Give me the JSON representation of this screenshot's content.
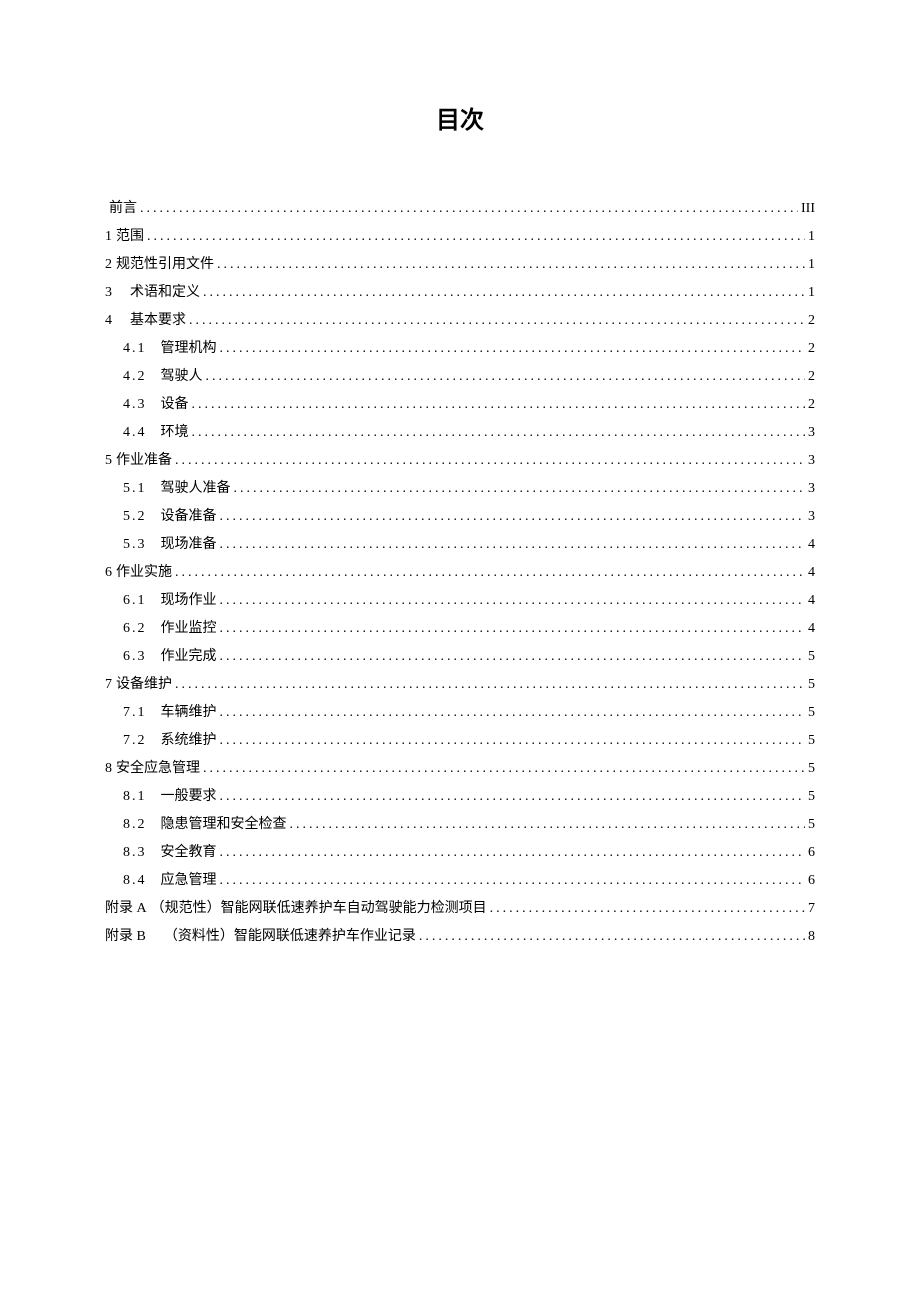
{
  "title": "目次",
  "entries": [
    {
      "level": 1,
      "num": "",
      "label": "前言",
      "page": "III",
      "numClass": "",
      "labelClass": ""
    },
    {
      "level": 1,
      "num": "1",
      "label": "范围",
      "page": "1",
      "numClass": "",
      "labelClass": ""
    },
    {
      "level": 1,
      "num": "2",
      "label": "规范性引用文件",
      "page": "1",
      "numClass": "",
      "labelClass": ""
    },
    {
      "level": 1,
      "num": "3",
      "label": "术语和定义",
      "page": "1",
      "numClass": "",
      "labelClass": "indent"
    },
    {
      "level": 1,
      "num": "4",
      "label": "基本要求",
      "page": "2",
      "numClass": "",
      "labelClass": "indent"
    },
    {
      "level": 2,
      "num": "4.1",
      "label": "管理机构",
      "page": "2",
      "numClass": "spaced",
      "labelClass": "wide-gap"
    },
    {
      "level": 2,
      "num": "4.2",
      "label": "驾驶人",
      "page": "2",
      "numClass": "spaced",
      "labelClass": "wide-gap"
    },
    {
      "level": 2,
      "num": "4.3",
      "label": "设备",
      "page": "2",
      "numClass": "spaced",
      "labelClass": "wide-gap"
    },
    {
      "level": 2,
      "num": "4.4",
      "label": "环境",
      "page": "3",
      "numClass": "spaced",
      "labelClass": "wide-gap"
    },
    {
      "level": 1,
      "num": "5",
      "label": "作业准备",
      "page": "3",
      "numClass": "",
      "labelClass": ""
    },
    {
      "level": 2,
      "num": "5.1",
      "label": "驾驶人准备",
      "page": "3",
      "numClass": "spaced",
      "labelClass": "wide-gap"
    },
    {
      "level": 2,
      "num": "5.2",
      "label": "设备准备",
      "page": "3",
      "numClass": "spaced",
      "labelClass": "wide-gap"
    },
    {
      "level": 2,
      "num": "5.3",
      "label": "现场准备",
      "page": "4",
      "numClass": "spaced",
      "labelClass": "wide-gap"
    },
    {
      "level": 1,
      "num": "6",
      "label": "作业实施",
      "page": "4",
      "numClass": "",
      "labelClass": ""
    },
    {
      "level": 2,
      "num": "6.1",
      "label": "现场作业",
      "page": "4",
      "numClass": "spaced",
      "labelClass": "wide-gap"
    },
    {
      "level": 2,
      "num": "6.2",
      "label": "作业监控",
      "page": "4",
      "numClass": "spaced",
      "labelClass": "wide-gap"
    },
    {
      "level": 2,
      "num": "6.3",
      "label": "作业完成",
      "page": "5",
      "numClass": "spaced",
      "labelClass": "wide-gap"
    },
    {
      "level": 1,
      "num": "7",
      "label": "设备维护",
      "page": "5",
      "numClass": "",
      "labelClass": ""
    },
    {
      "level": 2,
      "num": "7.1",
      "label": "车辆维护",
      "page": "5",
      "numClass": "spaced",
      "labelClass": "wide-gap"
    },
    {
      "level": 2,
      "num": "7.2",
      "label": "系统维护",
      "page": "5",
      "numClass": "spaced",
      "labelClass": "wide-gap"
    },
    {
      "level": 1,
      "num": "8",
      "label": "安全应急管理",
      "page": "5",
      "numClass": "",
      "labelClass": ""
    },
    {
      "level": 2,
      "num": "8.1",
      "label": "一般要求",
      "page": "5",
      "numClass": "spaced",
      "labelClass": "wide-gap"
    },
    {
      "level": 2,
      "num": "8.2",
      "label": "隐患管理和安全检查",
      "page": "5",
      "numClass": "spaced",
      "labelClass": "wide-gap"
    },
    {
      "level": 2,
      "num": "8.3",
      "label": "安全教育",
      "page": "6",
      "numClass": "spaced",
      "labelClass": "wide-gap"
    },
    {
      "level": 2,
      "num": "8.4",
      "label": "应急管理",
      "page": "6",
      "numClass": "spaced",
      "labelClass": "wide-gap"
    },
    {
      "level": 1,
      "num": "附录 A",
      "label": "（规范性）智能网联低速养护车自动驾驶能力检测项目",
      "page": "7",
      "numClass": "",
      "labelClass": ""
    },
    {
      "level": 1,
      "num": "附录 B",
      "label": "（资料性）智能网联低速养护车作业记录",
      "page": "8",
      "numClass": "",
      "labelClass": "indent"
    }
  ]
}
